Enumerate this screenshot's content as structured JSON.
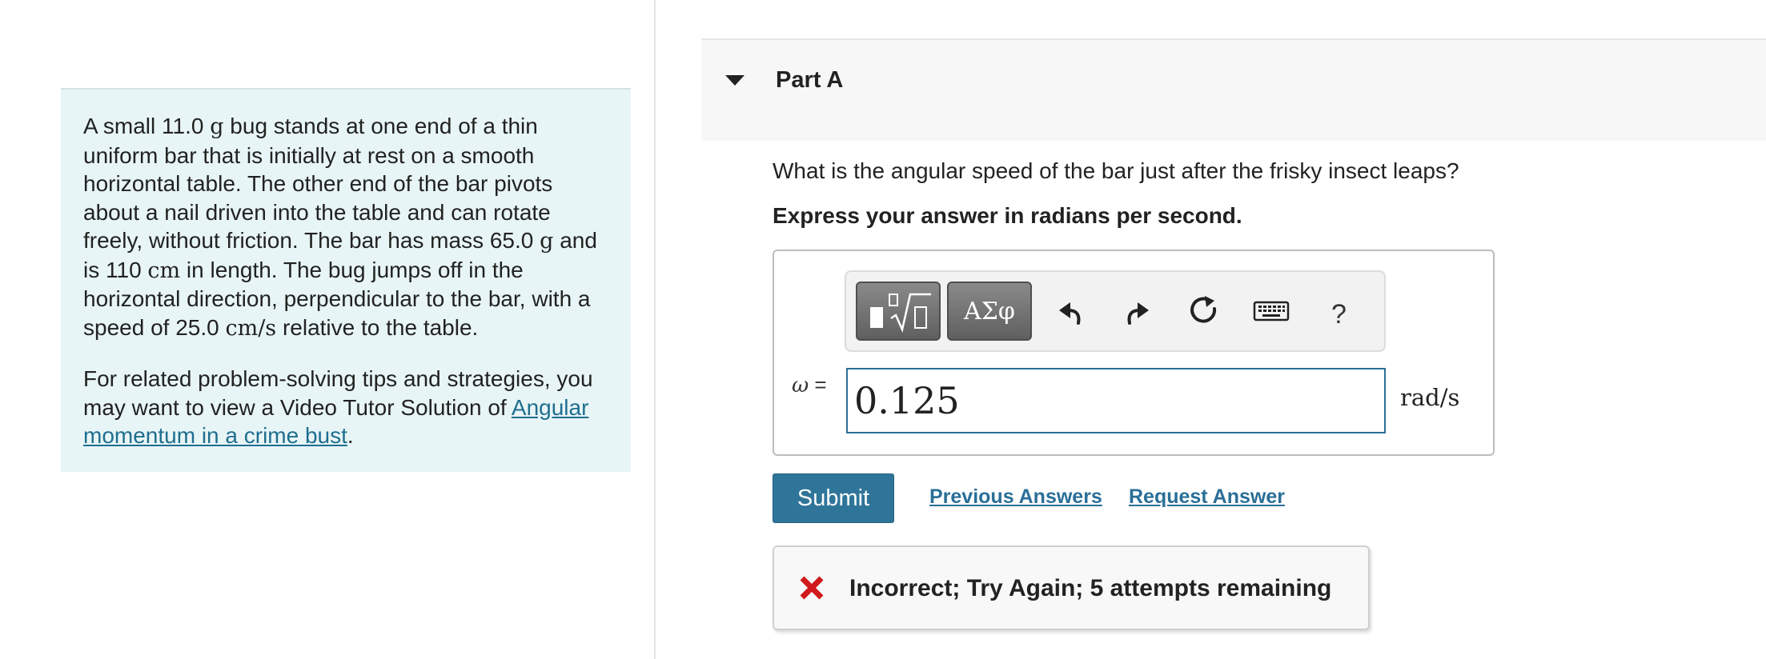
{
  "problem": {
    "para1": [
      {
        "t": "A small 11.0 "
      },
      {
        "m": "g"
      },
      {
        "t": " bug stands at one end of a thin uniform bar that is initially at rest on a smooth horizontal table. The other end of the bar pivots about a nail driven into the table and can rotate freely, without friction. The bar has mass 65.0 "
      },
      {
        "m": "g"
      },
      {
        "t": " and is 110 "
      },
      {
        "m": "cm"
      },
      {
        "t": " in length. The bug jumps off in the horizontal direction, perpendicular to the bar, with a speed of 25.0 "
      },
      {
        "m": "cm/s"
      },
      {
        "t": " relative to the table."
      }
    ],
    "para2_text": "For related problem-solving tips and strategies, you may want to view a Video Tutor Solution of ",
    "para2_link": "Angular momentum in a crime bust",
    "para2_end": "."
  },
  "part": {
    "title": "Part A"
  },
  "question": {
    "text": "What is the angular speed of the bar just after the frisky insect leaps?",
    "instruction": "Express your answer in radians per second."
  },
  "toolbar": {
    "greek_label": "ΑΣφ",
    "help_label": "?",
    "icons": [
      "templates-icon",
      "greek-icon",
      "undo-icon",
      "redo-icon",
      "reset-icon",
      "keyboard-icon",
      "help-icon"
    ]
  },
  "answer": {
    "variable": "ω",
    "equals": " =",
    "value": "0.125",
    "unit": "rad/s"
  },
  "actions": {
    "submit_label": "Submit",
    "previous_answers": "Previous Answers",
    "request_answer": "Request Answer"
  },
  "feedback": {
    "text": "Incorrect; Try Again; 5 attempts remaining",
    "status_color": "#d0191d"
  },
  "colors": {
    "panel_bg": "#e8f5f6",
    "link": "#2a6f97",
    "submit_bg": "#2f7599"
  }
}
